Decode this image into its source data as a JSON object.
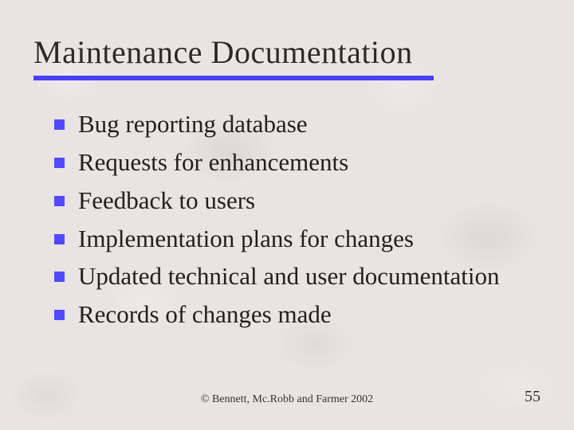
{
  "title": "Maintenance Documentation",
  "bullets": [
    "Bug reporting database",
    "Requests for enhancements",
    "Feedback to users",
    "Implementation plans for changes",
    "Updated technical and user documentation",
    "Records of changes made"
  ],
  "copyright": "©  Bennett, Mc.Robb and Farmer 2002",
  "page_number": "55",
  "colors": {
    "accent": "#4a3fff",
    "bullet": "#5448ff"
  }
}
